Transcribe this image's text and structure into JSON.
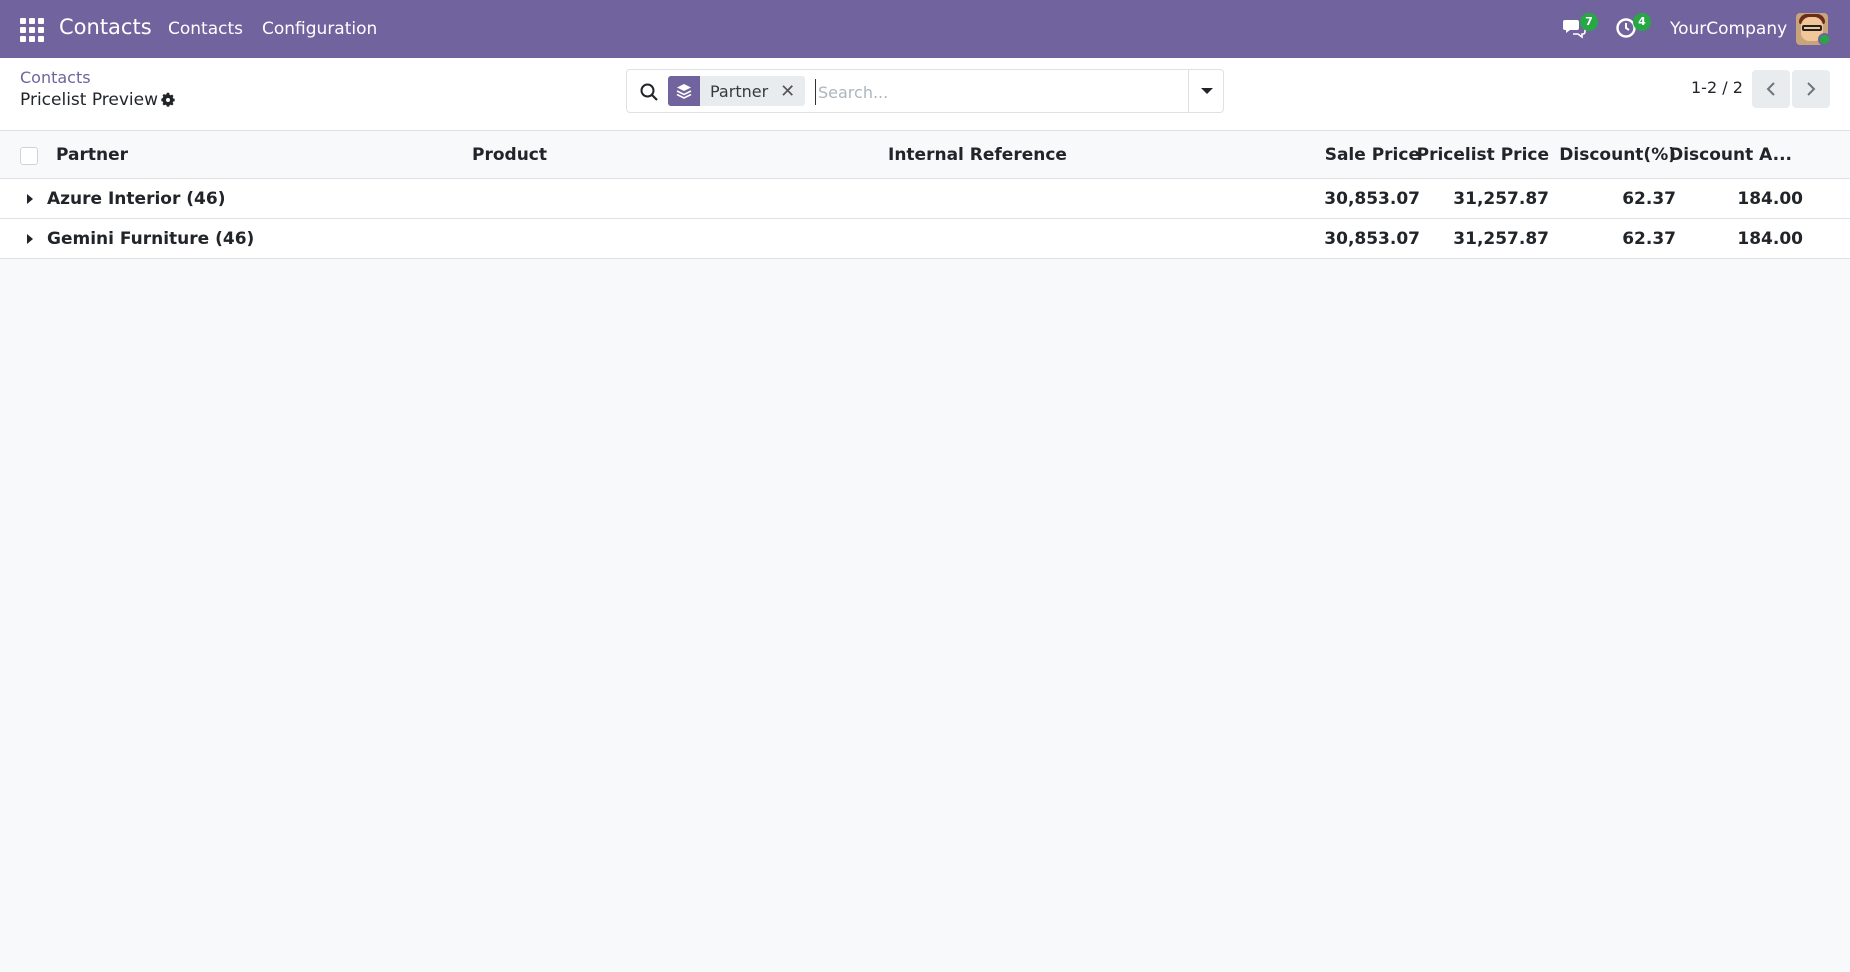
{
  "navbar": {
    "brand": "Contacts",
    "menu": [
      "Contacts",
      "Configuration"
    ],
    "messages_count": "7",
    "activities_count": "4",
    "company": "YourCompany"
  },
  "breadcrumb": {
    "parent": "Contacts",
    "current": "Pricelist Preview"
  },
  "search": {
    "facet": "Partner",
    "placeholder": "Search..."
  },
  "pager": {
    "value": "1-2 / 2"
  },
  "table": {
    "columns": [
      "Partner",
      "Product",
      "Internal Reference",
      "Sale Price",
      "Pricelist Price",
      "Discount(%)",
      "Discount A..."
    ],
    "groups": [
      {
        "name": "Azure Interior (46)",
        "sale_price": "30,853.07",
        "pricelist_price": "31,257.87",
        "discount_pct": "62.37",
        "discount_amount": "184.00"
      },
      {
        "name": "Gemini Furniture (46)",
        "sale_price": "30,853.07",
        "pricelist_price": "31,257.87",
        "discount_pct": "62.37",
        "discount_amount": "184.00"
      }
    ]
  },
  "colors": {
    "navbar": "#71639e",
    "badge": "#28a745"
  }
}
